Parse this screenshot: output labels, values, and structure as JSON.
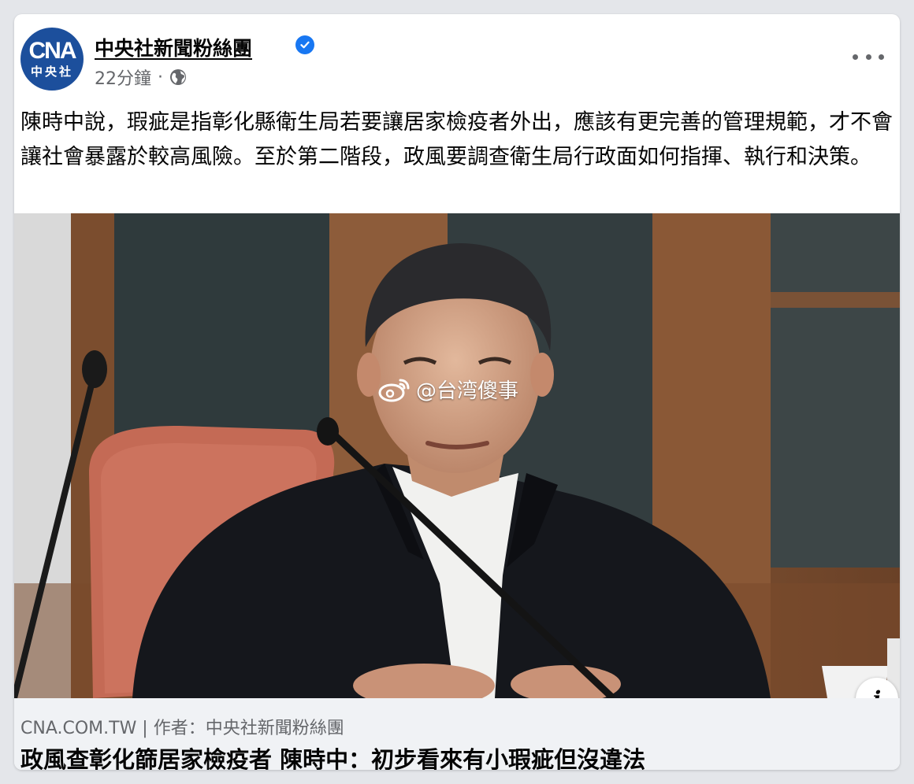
{
  "post": {
    "page_name": "中央社新聞粉絲團",
    "avatar": {
      "line1": "CNA",
      "line2": "中央社"
    },
    "time": "22分鐘",
    "separator": "·",
    "privacy_icon": "globe-icon",
    "verified_icon": "verified-badge-icon",
    "more_icon": "more-options-icon",
    "text": "陳時中說，瑕疵是指彰化縣衛生局若要讓居家檢疫者外出，應該有更完善的管理規範，才不會讓社會暴露於較高風險。至於第二階段，政風要調查衛生局行政面如何指揮、執行和決策。"
  },
  "image": {
    "watermark": "@台湾傻事",
    "watermark_icon": "weibo-icon",
    "info_label": "i"
  },
  "link_preview": {
    "domain": "CNA.COM.TW | 作者：中央社新聞粉絲團",
    "title": "政風查彰化篩居家檢疫者 陳時中：初步看來有小瑕疵但沒違法"
  },
  "colors": {
    "brand_blue": "#1877f2",
    "avatar_blue": "#1c4f9c",
    "secondary_text": "#65676b",
    "link_bg": "#f0f2f5"
  }
}
